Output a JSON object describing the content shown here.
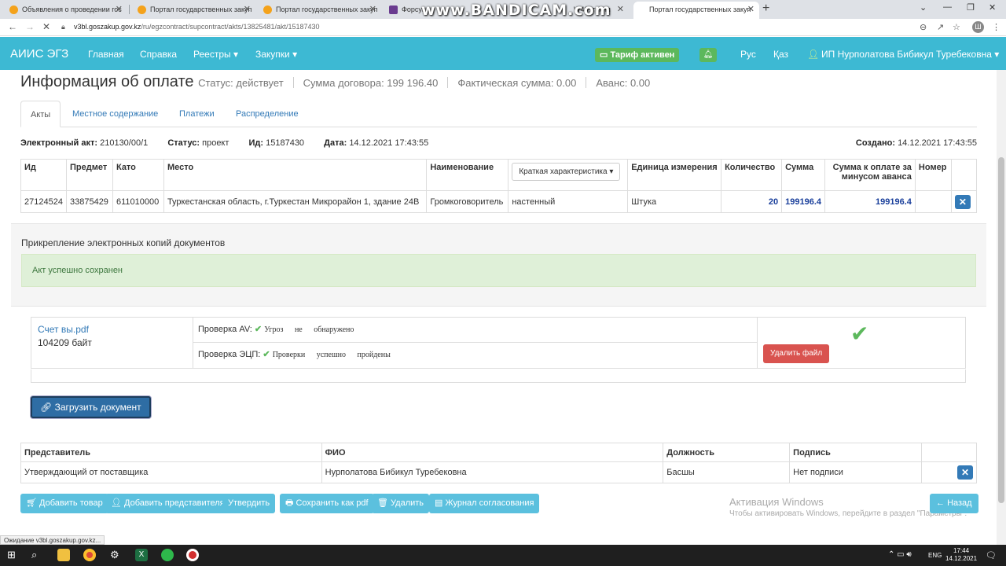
{
  "browser": {
    "tabs": [
      {
        "title": "Объявления о проведении гос"
      },
      {
        "title": "Портал государственных закуп"
      },
      {
        "title": "Портал государственных закуп"
      },
      {
        "title": "Форсуна"
      },
      {
        "title": "W40: техни"
      },
      {
        "title": "Портал государственных закуп"
      }
    ],
    "watermark": "www.BANDICAM.com",
    "url_host": "v3bl.goszakup.gov.kz",
    "url_path": "/ru/egzcontract/supcontract/akts/13825481/akt/15187430",
    "status_text": "Ожидание v3bl.goszakup.gov.kz...",
    "profile_letter": "Ш"
  },
  "nav": {
    "brand": "АИИС ЭГЗ",
    "links": [
      "Главная",
      "Справка",
      "Реестры ▾",
      "Закупки ▾"
    ],
    "tariff": "Тариф активен",
    "lang_ru": "Рус",
    "lang_kz": "Қаз",
    "user": "ИП Нурполатова Бибикул Туребековна ▾"
  },
  "page": {
    "title": "Информация об оплате",
    "status": "Статус: действует",
    "contract_sum": "Сумма договора: 199 196.40",
    "actual_sum": "Фактическая сумма: 0.00",
    "advance": "Аванс: 0.00",
    "tabs": [
      "Акты",
      "Местное содержание",
      "Платежи",
      "Распределение"
    ]
  },
  "act": {
    "label_number": "Электронный акт:",
    "number": "210130/00/1",
    "label_status": "Статус:",
    "status": "проект",
    "label_id": "Ид:",
    "id": "15187430",
    "label_date": "Дата:",
    "date": "14.12.2021 17:43:55",
    "label_created": "Создано:",
    "created": "14.12.2021 17:43:55"
  },
  "act_table": {
    "headers": {
      "id": "Ид",
      "subject": "Предмет",
      "kato": "Като",
      "place": "Место",
      "name": "Наименование",
      "short_char": "Краткая характеристика ▾",
      "unit": "Единица измерения",
      "qty": "Количество",
      "sum": "Сумма",
      "sum_net": "Сумма к оплате за минусом аванса",
      "number": "Номер"
    },
    "row": {
      "id": "27124524",
      "subject": "33875429",
      "kato": "611010000",
      "place": "Туркестанская область, г.Туркестан Микрорайон 1, здание 24В",
      "name": "Громкоговоритель",
      "short_char": "настенный",
      "unit": "Штука",
      "qty": "20",
      "sum": "199196.4",
      "sum_net": "199196.4",
      "number": ""
    }
  },
  "attach": {
    "title": "Прикрепление электронных копий документов",
    "alert": "Акт успешно сохранен",
    "file_name": "Счет вы.pdf",
    "file_size": "104209 байт",
    "av_label": "Проверка AV:",
    "av_result": "Угроз не обнаружено",
    "sig_label": "Проверка ЭЦП:",
    "sig_result": "Проверки успешно пройдены",
    "delete_label": "Удалить файл",
    "upload_label": "Загрузить документ"
  },
  "rep_table": {
    "headers": {
      "role": "Представитель",
      "fio": "ФИО",
      "position": "Должность",
      "sign": "Подпись"
    },
    "row": {
      "role": "Утверждающий от поставщика",
      "fio": "Нурполатова Бибикул Туребековна",
      "position": "Басшы",
      "sign": "Нет подписи"
    }
  },
  "actions": {
    "add_item": "Добавить товар",
    "add_rep": "Добавить представителя",
    "approve": "Утвердить",
    "save_pdf": "Сохранить как pdf",
    "delete": "Удалить",
    "journal": "Журнал согласования",
    "back": "Назад"
  },
  "windows": {
    "activation_title": "Активация Windows",
    "activation_sub": "Чтобы активировать Windows, перейдите в раздел \"Параметры\".",
    "time": "17:44",
    "date": "14.12.2021",
    "lang": "ENG"
  }
}
